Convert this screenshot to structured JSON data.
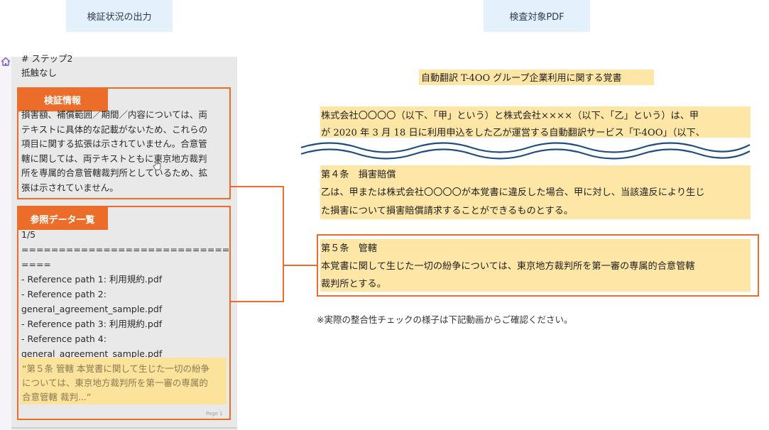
{
  "headers": {
    "left": "検証状況の出力",
    "right": "検査対象PDF"
  },
  "left_panel": {
    "step_title": "# ステップ2",
    "step_result": "抵触なし",
    "verify_label": "検証情報",
    "verify_lines": [
      "損害額、補償範囲／期間／内容については、両",
      "テキストに具体的な記載がないため、これらの",
      "項目に関する拡張は示されていません。合意管",
      "轄に関しては、両テキストともに東京地方裁判",
      "所を専属的合意管轄裁判所としているため、拡",
      "張は示されていません。"
    ],
    "ref_label": "参照データ一覧",
    "ref_lines": [
      "1/5",
      "=================================",
      "====",
      "- Reference path 1: 利用規約.pdf",
      "- Reference path 2:",
      "general_agreement_sample.pdf",
      "- Reference path 3: 利用規約.pdf",
      "- Reference path 4:",
      "general_agreement_sample.pdf"
    ],
    "quote_lines": [
      "“第５条 管轄 本覚書に関して生じた一切の紛争",
      "については、東京地方裁判所を第一審の専属的",
      "合意管轄 裁判...”"
    ],
    "page_label": "Page 1"
  },
  "pdf": {
    "title": "自動翻訳 T-4OO グループ企業利用に関する覚書",
    "intro_lines": [
      "株式会社〇〇〇〇（以下、「甲」という）と株式会社××××（以下、「乙」という）は、甲",
      "が 2020 年 3 月 18 日に利用申込をした乙が運営する自動翻訳サービス「T-4OO」（以下、"
    ],
    "article4_lines": [
      "第４条　損害賠償",
      "乙は、甲または株式会社〇〇〇〇が本覚書に違反した場合、甲に対し、当該違反により生じ",
      "た損害について損害賠償請求することができるものとする。"
    ],
    "article5_lines": [
      "第５条　管轄",
      "本覚書に関して生じた一切の紛争については、東京地方裁判所を第一審の専属的合意管轄",
      "裁判所とする。"
    ],
    "footnote": "※実際の整合性チェックの様子は下記動画からご確認ください。"
  },
  "colors": {
    "accent_orange": "#ec6d2a",
    "highlight_yellow": "#fde6a6",
    "header_bg": "#e4f0fb",
    "wave_blue": "#1f4f80"
  }
}
